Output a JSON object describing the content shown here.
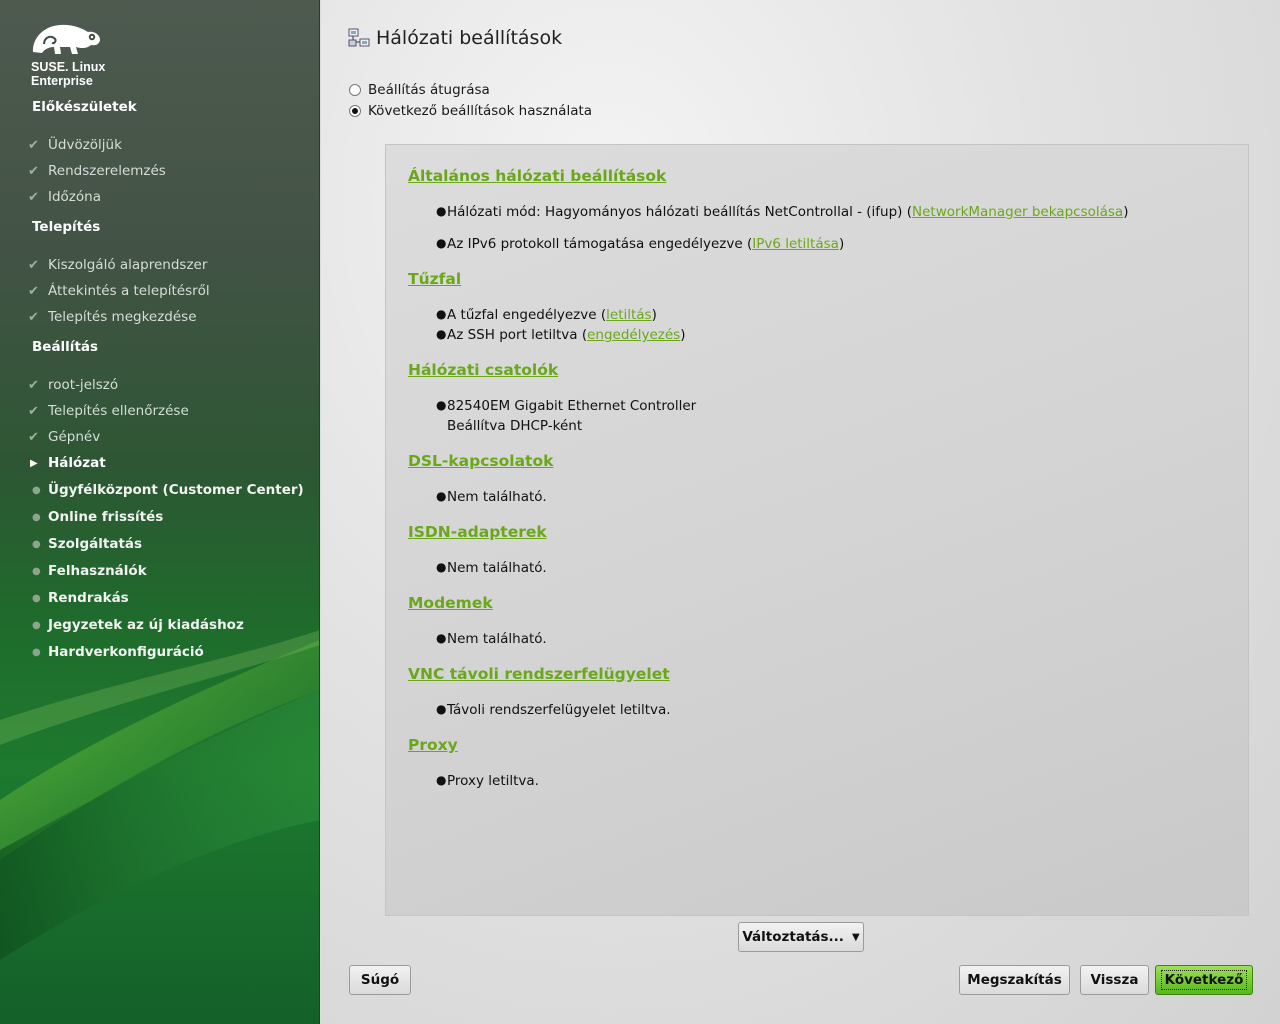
{
  "sidebar": {
    "logo": {
      "line1": "SUSE. Linux",
      "line2": "Enterprise"
    },
    "sections": [
      {
        "title": "Előkészületek",
        "steps": [
          {
            "label": "Üdvözöljük",
            "state": "done"
          },
          {
            "label": "Rendszerelemzés",
            "state": "done"
          },
          {
            "label": "Időzóna",
            "state": "done"
          }
        ]
      },
      {
        "title": "Telepítés",
        "steps": [
          {
            "label": "Kiszolgáló alaprendszer",
            "state": "done"
          },
          {
            "label": "Áttekintés a telepítésről",
            "state": "done"
          },
          {
            "label": "Telepítés megkezdése",
            "state": "done"
          }
        ]
      },
      {
        "title": "Beállítás",
        "steps": [
          {
            "label": "root-jelszó",
            "state": "done"
          },
          {
            "label": "Telepítés ellenőrzése",
            "state": "done"
          },
          {
            "label": "Gépnév",
            "state": "done"
          },
          {
            "label": "Hálózat",
            "state": "current"
          },
          {
            "label": "Ügyfélközpont (Customer Center)",
            "state": "todo"
          },
          {
            "label": "Online frissítés",
            "state": "todo"
          },
          {
            "label": "Szolgáltatás",
            "state": "todo"
          },
          {
            "label": "Felhasználók",
            "state": "todo"
          },
          {
            "label": "Rendrakás",
            "state": "todo"
          },
          {
            "label": "Jegyzetek az új kiadáshoz",
            "state": "todo"
          },
          {
            "label": "Hardverkonfiguráció",
            "state": "todo"
          }
        ]
      }
    ],
    "icons": {
      "done": "checkmark-icon",
      "current": "triangle-right-icon",
      "todo": "small-dot-icon"
    }
  },
  "main": {
    "title": "Hálózati beállítások",
    "title_icon": "network-settings-icon",
    "options": {
      "skip": {
        "label": "Beállítás átugrása",
        "checked": false
      },
      "use": {
        "label": "Következő beállítások használata",
        "checked": true
      }
    },
    "sections": {
      "general": {
        "title": "Általános hálózati beállítások",
        "item1_text": "Hálózati mód: Hagyományos hálózati beállítás NetControllal - (ifup) (",
        "item1_link": "NetworkManager bekapcsolása",
        "item2_text": "Az IPv6 protokoll támogatása engedélyezve (",
        "item2_link": "IPv6 letiltása"
      },
      "firewall": {
        "title": "Tűzfal",
        "item1_text": "A tűzfal engedélyezve (",
        "item1_link": "letiltás",
        "item2_text": "Az SSH port letiltva (",
        "item2_link": "engedélyezés"
      },
      "interfaces": {
        "title": "Hálózati csatolók",
        "item1_line1": "82540EM Gigabit Ethernet Controller",
        "item1_line2": "Beállítva DHCP-ként"
      },
      "dsl": {
        "title": "DSL-kapcsolatok",
        "item1": "Nem található."
      },
      "isdn": {
        "title": "ISDN-adapterek",
        "item1": "Nem található."
      },
      "modems": {
        "title": "Modemek",
        "item1": "Nem található."
      },
      "vnc": {
        "title": "VNC távoli rendszerfelügyelet",
        "item1": "Távoli rendszerfelügyelet letiltva."
      },
      "proxy": {
        "title": "Proxy",
        "item1": "Proxy letiltva."
      }
    },
    "buttons": {
      "change": "Változtatás...",
      "help": "Súgó",
      "abort": "Megszakítás",
      "back": "Vissza",
      "next": "Következő"
    },
    "colors": {
      "link": "#6aa81a",
      "primary_button": "#56b81c"
    }
  }
}
